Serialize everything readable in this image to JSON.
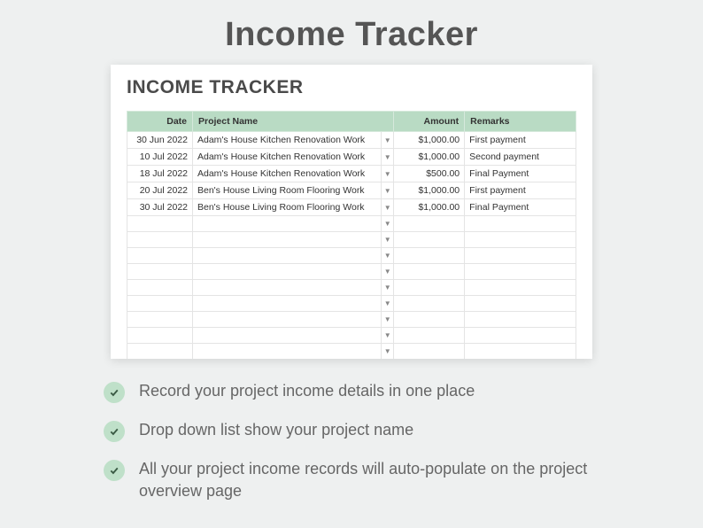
{
  "title": "Income Tracker",
  "sheet": {
    "heading": "INCOME TRACKER",
    "columns": {
      "date": "Date",
      "project": "Project Name",
      "amount": "Amount",
      "remarks": "Remarks"
    },
    "rows": [
      {
        "date": "30 Jun 2022",
        "project": "Adam's House Kitchen Renovation Work",
        "amount": "$1,000.00",
        "remarks": "First payment"
      },
      {
        "date": "10 Jul 2022",
        "project": "Adam's House Kitchen Renovation Work",
        "amount": "$1,000.00",
        "remarks": "Second payment"
      },
      {
        "date": "18 Jul 2022",
        "project": "Adam's House Kitchen Renovation Work",
        "amount": "$500.00",
        "remarks": "Final Payment"
      },
      {
        "date": "20 Jul 2022",
        "project": "Ben's House Living Room Flooring Work",
        "amount": "$1,000.00",
        "remarks": "First payment"
      },
      {
        "date": "30 Jul 2022",
        "project": "Ben's House Living Room Flooring Work",
        "amount": "$1,000.00",
        "remarks": "Final Payment"
      }
    ],
    "emptyRowCount": 11
  },
  "features": [
    "Record your project income details in one place",
    "Drop down list show your project name",
    "All your project income records will auto-populate on the project overview page"
  ]
}
